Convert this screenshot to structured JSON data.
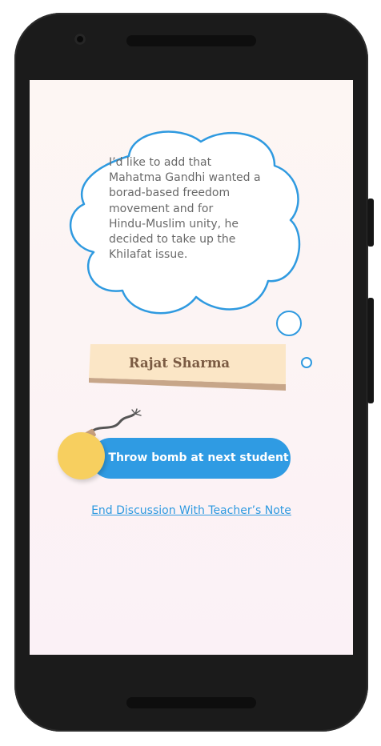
{
  "thought": {
    "text": "I’d like to add that\nMahatma Gandhi wanted a\nborad-based freedom\nmovement and for\nHindu-Muslim unity, he\ndecided to take up the\nKhilafat issue."
  },
  "student": {
    "name": "Rajat Sharma"
  },
  "actions": {
    "throw_bomb_label": "Throw bomb at next student",
    "end_discussion_label": "End Discussion With Teacher’s Note"
  },
  "colors": {
    "accent_blue": "#2f9be3",
    "bomb_yellow": "#f7cf5f",
    "name_card": "#fbe6c6",
    "name_card_shadow": "#c7a689",
    "name_text": "#7b5b43"
  },
  "icons": [
    "thought-cloud-icon",
    "bomb-icon",
    "fuse-icon",
    "spark-icon"
  ]
}
